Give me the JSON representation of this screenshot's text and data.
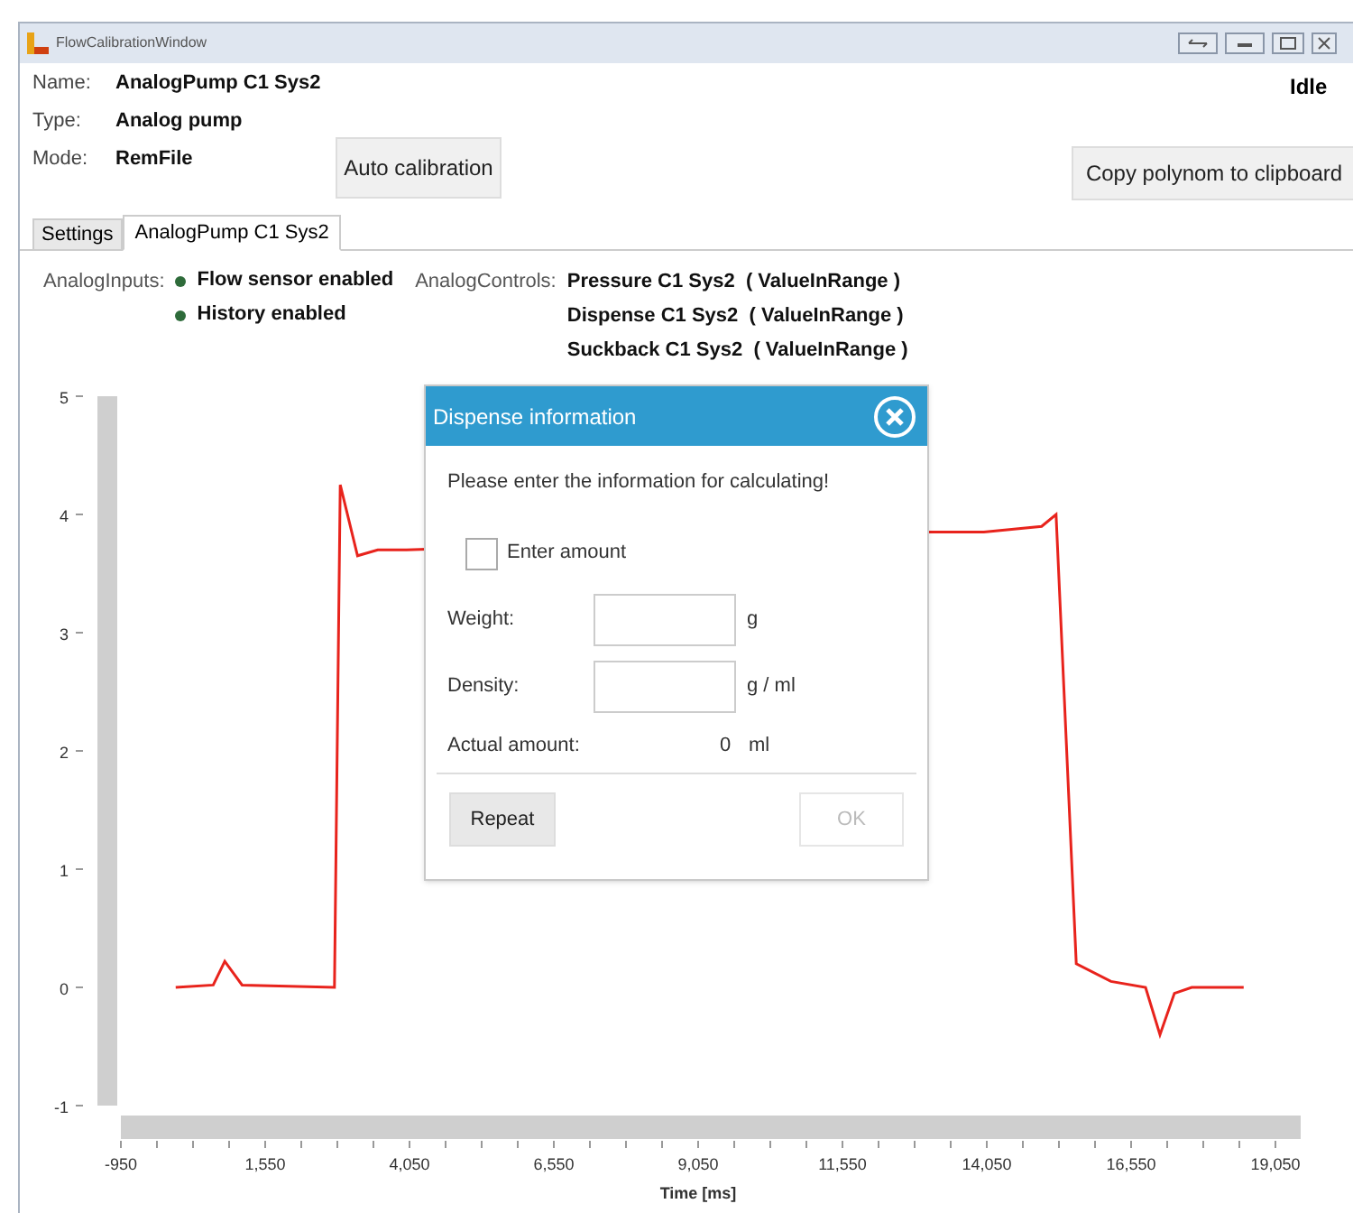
{
  "window": {
    "title": "FlowCalibrationWindow"
  },
  "info": [
    {
      "label": "Name:",
      "value": "AnalogPump C1 Sys2"
    },
    {
      "label": "Type:",
      "value": "Analog pump"
    },
    {
      "label": "Mode:",
      "value": "RemFile"
    }
  ],
  "status": "Idle",
  "buttons": {
    "auto_calibration": "Auto calibration",
    "copy_polynom": "Copy polynom to clipboard"
  },
  "tabs": [
    {
      "label": "Settings",
      "selected": false
    },
    {
      "label": "AnalogPump C1 Sys2",
      "selected": true
    }
  ],
  "analog_inputs": {
    "label": "AnalogInputs:",
    "items": [
      {
        "text": "Flow sensor enabled",
        "color": "#2e6b3a"
      },
      {
        "text": "History enabled",
        "color": "#2e6b3a"
      }
    ]
  },
  "analog_controls": {
    "label": "AnalogControls:",
    "items": [
      "Pressure C1 Sys2  ( ValueInRange )",
      "Dispense C1 Sys2  ( ValueInRange )",
      "Suckback C1 Sys2  ( ValueInRange )"
    ]
  },
  "chart_data": {
    "type": "line",
    "xlabel": "Time [ms]",
    "xticks": [
      {
        "value": -950,
        "label": "-950"
      },
      {
        "value": 1550,
        "label": "1,550"
      },
      {
        "value": 4050,
        "label": "4,050"
      },
      {
        "value": 6550,
        "label": "6,550"
      },
      {
        "value": 9050,
        "label": "9,050"
      },
      {
        "value": 11550,
        "label": "11,550"
      },
      {
        "value": 14050,
        "label": "14,050"
      },
      {
        "value": 16550,
        "label": "16,550"
      },
      {
        "value": 19050,
        "label": "19,050"
      }
    ],
    "yticks": [
      -1,
      0,
      1,
      2,
      3,
      4,
      5
    ],
    "xlim": [
      -950,
      19050
    ],
    "ylim": [
      -1,
      5
    ],
    "x": [
      0,
      650,
      850,
      1150,
      2750,
      2850,
      3150,
      3500,
      4000,
      13000,
      14000,
      15000,
      15250,
      15600,
      16200,
      16800,
      17050,
      17300,
      17600,
      18500
    ],
    "series": [
      {
        "color": "#e8231c",
        "values": [
          0,
          0.02,
          0.22,
          0.02,
          0,
          4.25,
          3.65,
          3.7,
          3.7,
          3.85,
          3.85,
          3.9,
          4.0,
          0.2,
          0.05,
          0.0,
          -0.4,
          -0.05,
          0,
          0
        ]
      }
    ]
  },
  "dialog": {
    "title": "Dispense information",
    "message": "Please enter the information for calculating!",
    "enter_amount": {
      "label": "Enter amount",
      "checked": false
    },
    "fields": [
      {
        "label": "Weight:",
        "unit": "g"
      },
      {
        "label": "Density:",
        "unit": "g / ml"
      }
    ],
    "actual_amount": {
      "label": "Actual amount:",
      "value": "0",
      "unit": "ml"
    },
    "buttons": [
      {
        "label": "Repeat",
        "disabled": false
      },
      {
        "label": "OK",
        "disabled": true
      }
    ]
  }
}
